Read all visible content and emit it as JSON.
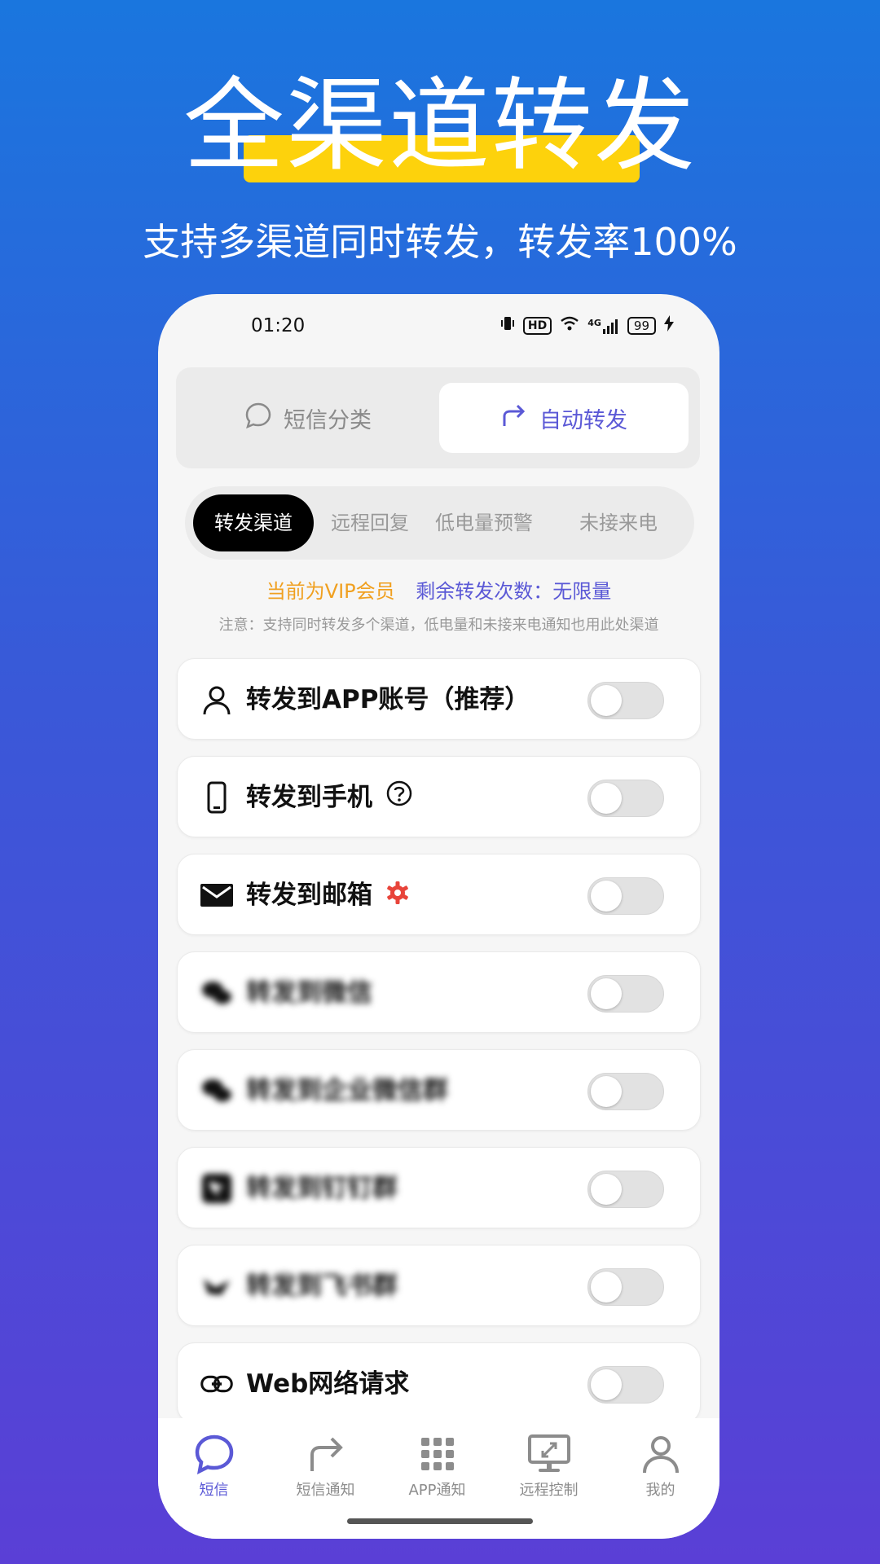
{
  "hero": {
    "title": "全渠道转发",
    "subtitle": "支持多渠道同时转发，转发率100%"
  },
  "status_bar": {
    "time": "01:20",
    "hd": "HD",
    "network": "4G",
    "battery": "99"
  },
  "segment": {
    "left_label": "短信分类",
    "right_label": "自动转发"
  },
  "tabs": [
    "转发渠道",
    "远程回复",
    "低电量预警",
    "未接来电"
  ],
  "active_tab": 0,
  "vip": {
    "status": "当前为VIP会员",
    "remaining": "剩余转发次数：无限量"
  },
  "note": "注意：支持同时转发多个渠道，低电量和未接来电通知也用此处渠道",
  "channels": [
    {
      "label": "转发到APP账号（推荐）",
      "icon": "person-icon",
      "enabled": false
    },
    {
      "label": "转发到手机",
      "icon": "phone-icon",
      "enabled": false,
      "extra": "help-icon"
    },
    {
      "label": "转发到邮箱",
      "icon": "mail-icon",
      "enabled": false,
      "extra": "settings-gear-icon"
    },
    {
      "label": "转发到微信",
      "icon": "wechat-icon",
      "enabled": false
    },
    {
      "label": "转发到企业微信群",
      "icon": "wecom-icon",
      "enabled": false
    },
    {
      "label": "转发到钉钉群",
      "icon": "dingtalk-icon",
      "enabled": false
    },
    {
      "label": "转发到飞书群",
      "icon": "feishu-icon",
      "enabled": false
    },
    {
      "label": "Web网络请求",
      "icon": "link-icon",
      "enabled": false
    }
  ],
  "nav": [
    {
      "label": "短信",
      "icon": "chat-bubble-icon",
      "active": true
    },
    {
      "label": "短信通知",
      "icon": "forward-arrow-icon",
      "active": false
    },
    {
      "label": "APP通知",
      "icon": "app-grid-icon",
      "active": false
    },
    {
      "label": "远程控制",
      "icon": "remote-desktop-icon",
      "active": false
    },
    {
      "label": "我的",
      "icon": "profile-icon",
      "active": false
    }
  ],
  "colors": {
    "accent": "#5b59d6",
    "highlight": "#fdd20c",
    "vip": "#f0a020",
    "settings_gear": "#e8443a"
  }
}
